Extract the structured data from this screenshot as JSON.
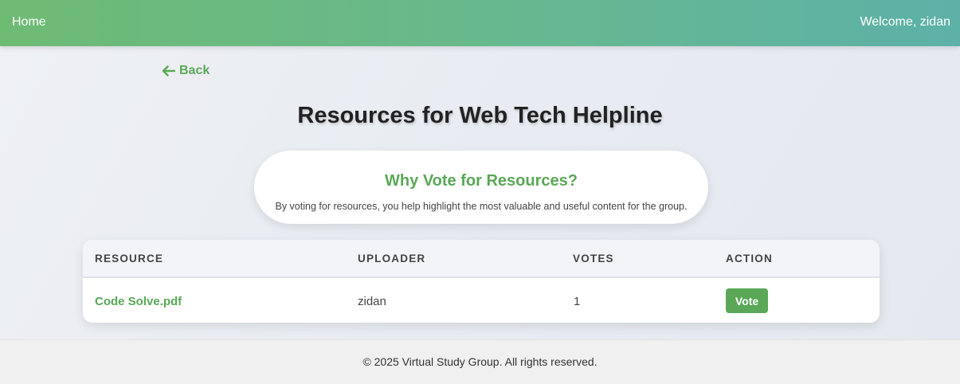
{
  "navbar": {
    "home_label": "Home",
    "welcome_text": "Welcome, zidan"
  },
  "back": {
    "label": "Back",
    "icon": "arrow-left-icon"
  },
  "page": {
    "title": "Resources for Web Tech Helpline"
  },
  "info_card": {
    "title": "Why Vote for Resources?",
    "text": "By voting for resources, you help highlight the most valuable and useful content for the group."
  },
  "table": {
    "headers": [
      "RESOURCE",
      "UPLOADER",
      "VOTES",
      "ACTION"
    ],
    "rows": [
      {
        "resource": "Code Solve.pdf",
        "uploader": "zidan",
        "votes": "1",
        "action_label": "Vote"
      }
    ]
  },
  "footer": {
    "text": "© 2025 Virtual Study Group. All rights reserved."
  },
  "colors": {
    "accent_green": "#5aa857",
    "navbar_start": "#6ebb74",
    "navbar_end": "#5db1a7"
  }
}
